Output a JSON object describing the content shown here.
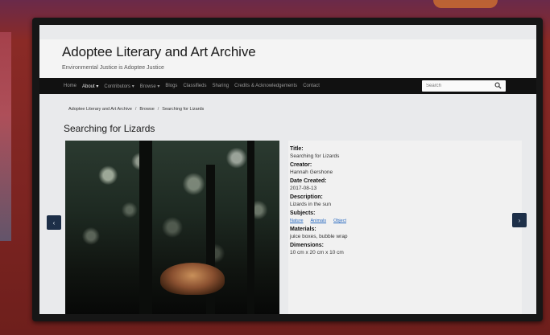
{
  "site": {
    "title": "Adoptee Literary and Art Archive",
    "subtitle": "Environmental Justice is Adoptee Justice"
  },
  "nav": {
    "items": [
      {
        "label": "Home",
        "active": false
      },
      {
        "label": "About ▾",
        "active": true
      },
      {
        "label": "Contributors ▾",
        "active": false
      },
      {
        "label": "Browse ▾",
        "active": false
      },
      {
        "label": "Blogs",
        "active": false
      },
      {
        "label": "Classifieds",
        "active": false
      },
      {
        "label": "Sharing",
        "active": false
      },
      {
        "label": "Credits & Acknowledgements",
        "active": false
      },
      {
        "label": "Contact",
        "active": false
      }
    ],
    "search_placeholder": "Search"
  },
  "breadcrumb": [
    "Adoptee Literary and Art Archive",
    "Browse",
    "Searching for Lizards"
  ],
  "page_title": "Searching for Lizards",
  "metadata": {
    "title_label": "Title:",
    "title_value": "Searching for Lizards",
    "creator_label": "Creator:",
    "creator_value": "Hannah Gershone",
    "date_label": "Date Created:",
    "date_value": "2017-08-13",
    "description_label": "Description:",
    "description_value": "Lizards in the sun",
    "subjects_label": "Subjects:",
    "subjects": [
      "Nature",
      "Animals",
      "Object"
    ],
    "materials_label": "Materials:",
    "materials_value": "juice boxes, bubble wrap",
    "dimensions_label": "Dimensions:",
    "dimensions_value": "10 cm x 20 cm x 10 cm"
  },
  "carousel": {
    "prev_icon": "‹",
    "next_icon": "›"
  },
  "colors": {
    "nav_bg": "#111111",
    "accent_link": "#2a6ac0",
    "arrow_bg": "#1d2f48"
  }
}
